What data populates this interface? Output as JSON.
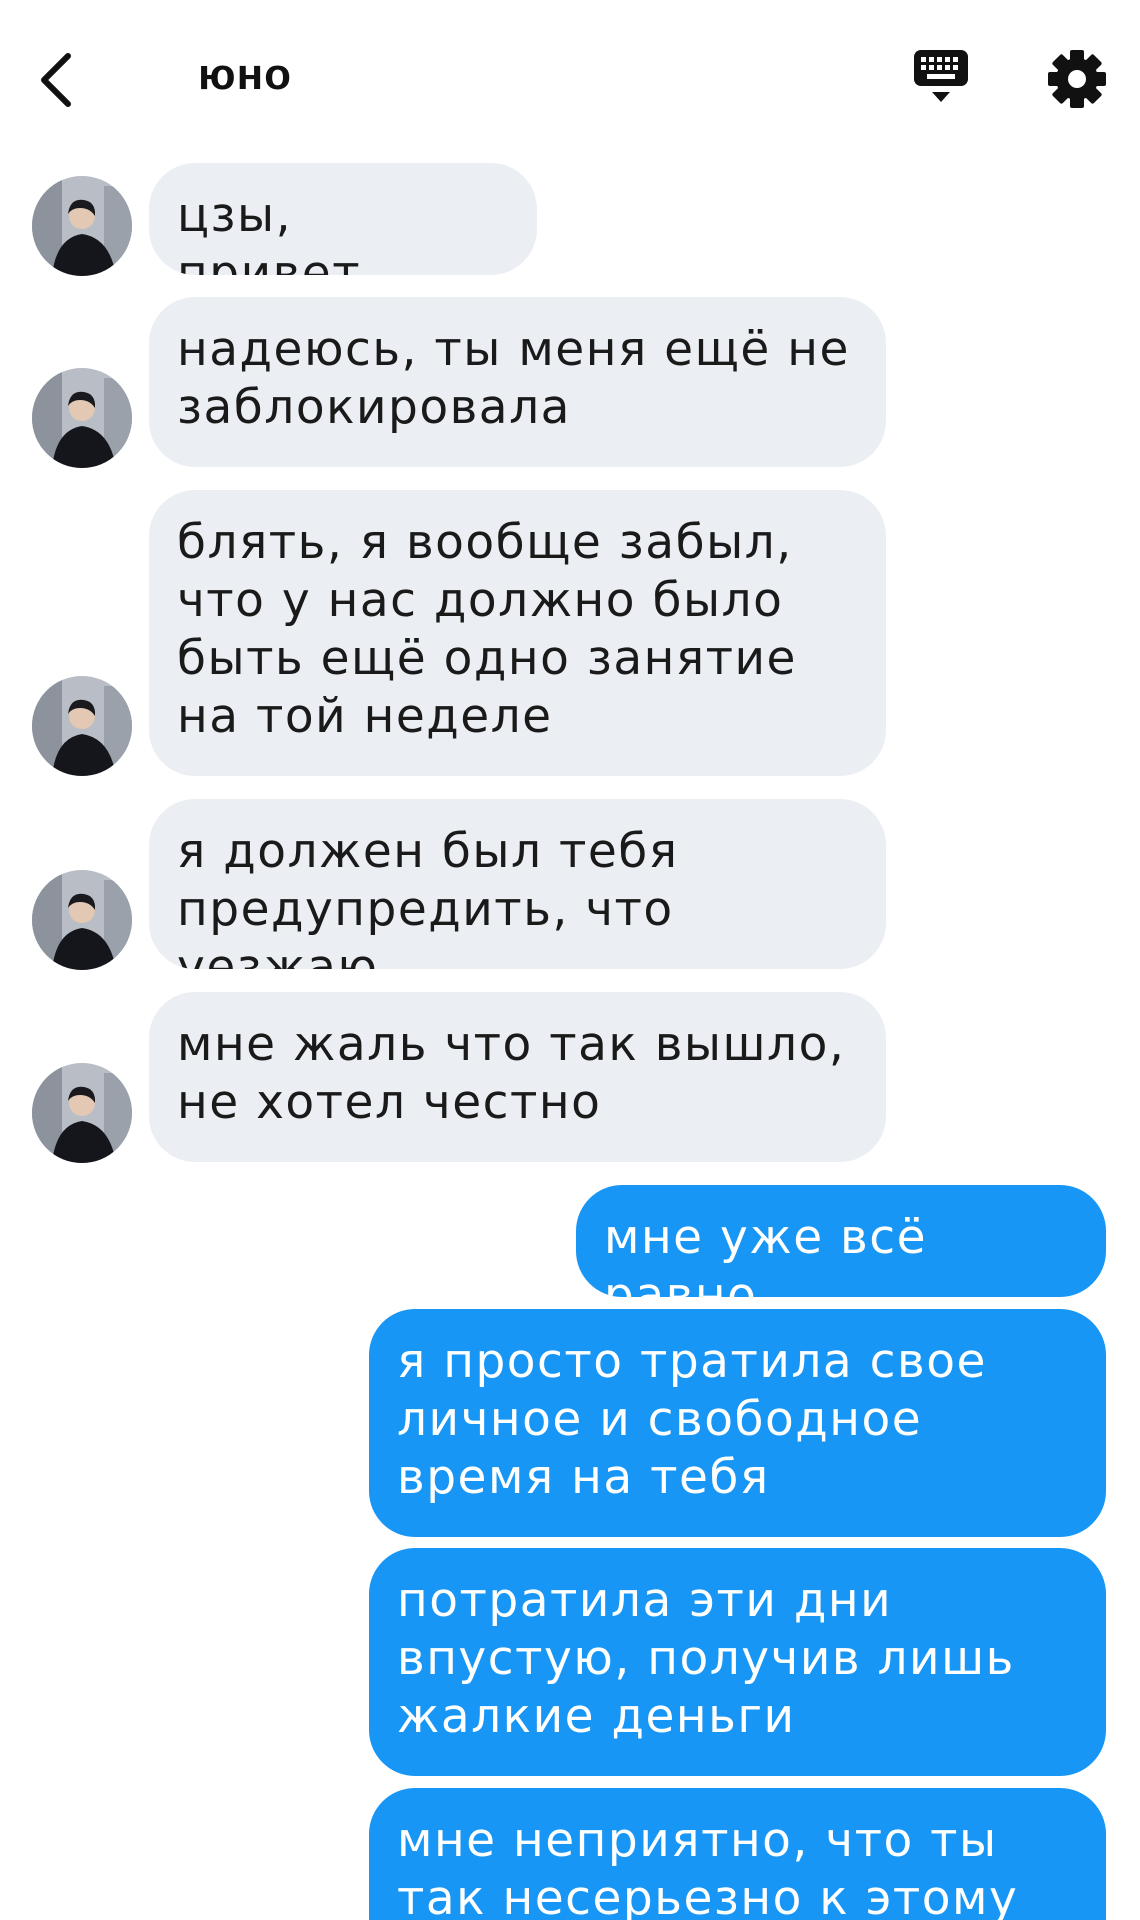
{
  "header": {
    "title": "юно",
    "icons": {
      "back": "chevron-left-icon",
      "keyboard": "keyboard-icon",
      "settings": "gear-icon"
    }
  },
  "colors": {
    "incoming_bubble": "#ebeef3",
    "outgoing_bubble": "#1796f5",
    "outgoing_text": "#ffffff",
    "incoming_text": "#1a1a1a"
  },
  "messages": [
    {
      "from": "contact",
      "text": "цзы, привет.."
    },
    {
      "from": "contact",
      "text": "надеюсь, ты меня ещё не заблокировала"
    },
    {
      "from": "contact",
      "text": "блять, я вообще забыл, что у нас должно было быть ещё одно занятие на той неделе"
    },
    {
      "from": "contact",
      "text": "я должен был тебя предупредить, что уезжаю"
    },
    {
      "from": "contact",
      "text": "мне жаль что так вышло, не хотел честно"
    },
    {
      "from": "me",
      "text": "мне уже всё равно"
    },
    {
      "from": "me",
      "text": "я просто тратила свое личное и свободное время на тебя"
    },
    {
      "from": "me",
      "text": "потратила эти дни впустую, получив лишь жалкие деньги"
    },
    {
      "from": "me",
      "text": "мне неприятно, что ты так несерьезно к этому"
    }
  ]
}
